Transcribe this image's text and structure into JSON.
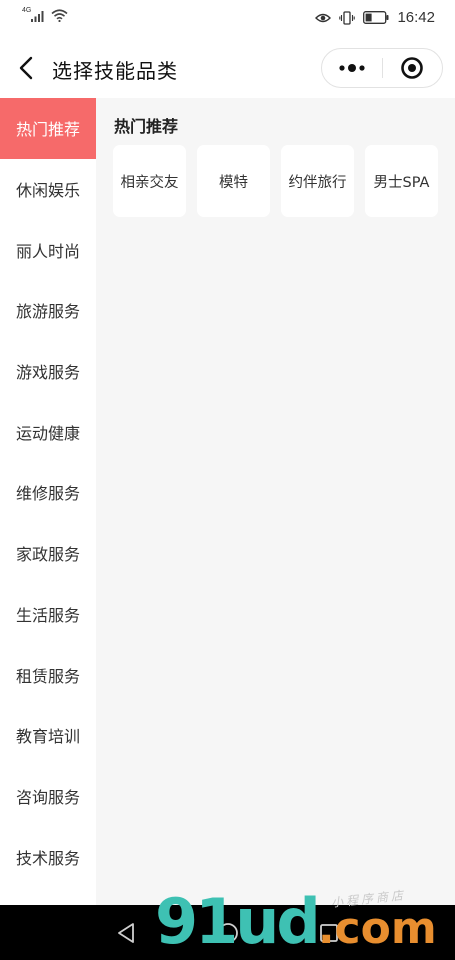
{
  "status_bar": {
    "network_label": "4G",
    "time": "16:42"
  },
  "nav": {
    "title": "选择技能品类"
  },
  "sidebar": {
    "items": [
      {
        "label": "热门推荐",
        "active": true
      },
      {
        "label": "休闲娱乐",
        "active": false
      },
      {
        "label": "丽人时尚",
        "active": false
      },
      {
        "label": "旅游服务",
        "active": false
      },
      {
        "label": "游戏服务",
        "active": false
      },
      {
        "label": "运动健康",
        "active": false
      },
      {
        "label": "维修服务",
        "active": false
      },
      {
        "label": "家政服务",
        "active": false
      },
      {
        "label": "生活服务",
        "active": false
      },
      {
        "label": "租赁服务",
        "active": false
      },
      {
        "label": "教育培训",
        "active": false
      },
      {
        "label": "咨询服务",
        "active": false
      },
      {
        "label": "技术服务",
        "active": false
      }
    ]
  },
  "content": {
    "section_title": "热门推荐",
    "chips": [
      "相亲交友",
      "模特",
      "约伴旅行",
      "男士SPA"
    ]
  },
  "watermark": {
    "logo_part1": "91",
    "logo_part2": "ud",
    "logo_part3": ".com",
    "tagline": "小程序商店"
  },
  "colors": {
    "accent": "#f66a6a",
    "content_bg": "#f6f6f6",
    "watermark_teal": "#3ec1b3",
    "watermark_orange": "#e88e2f"
  }
}
